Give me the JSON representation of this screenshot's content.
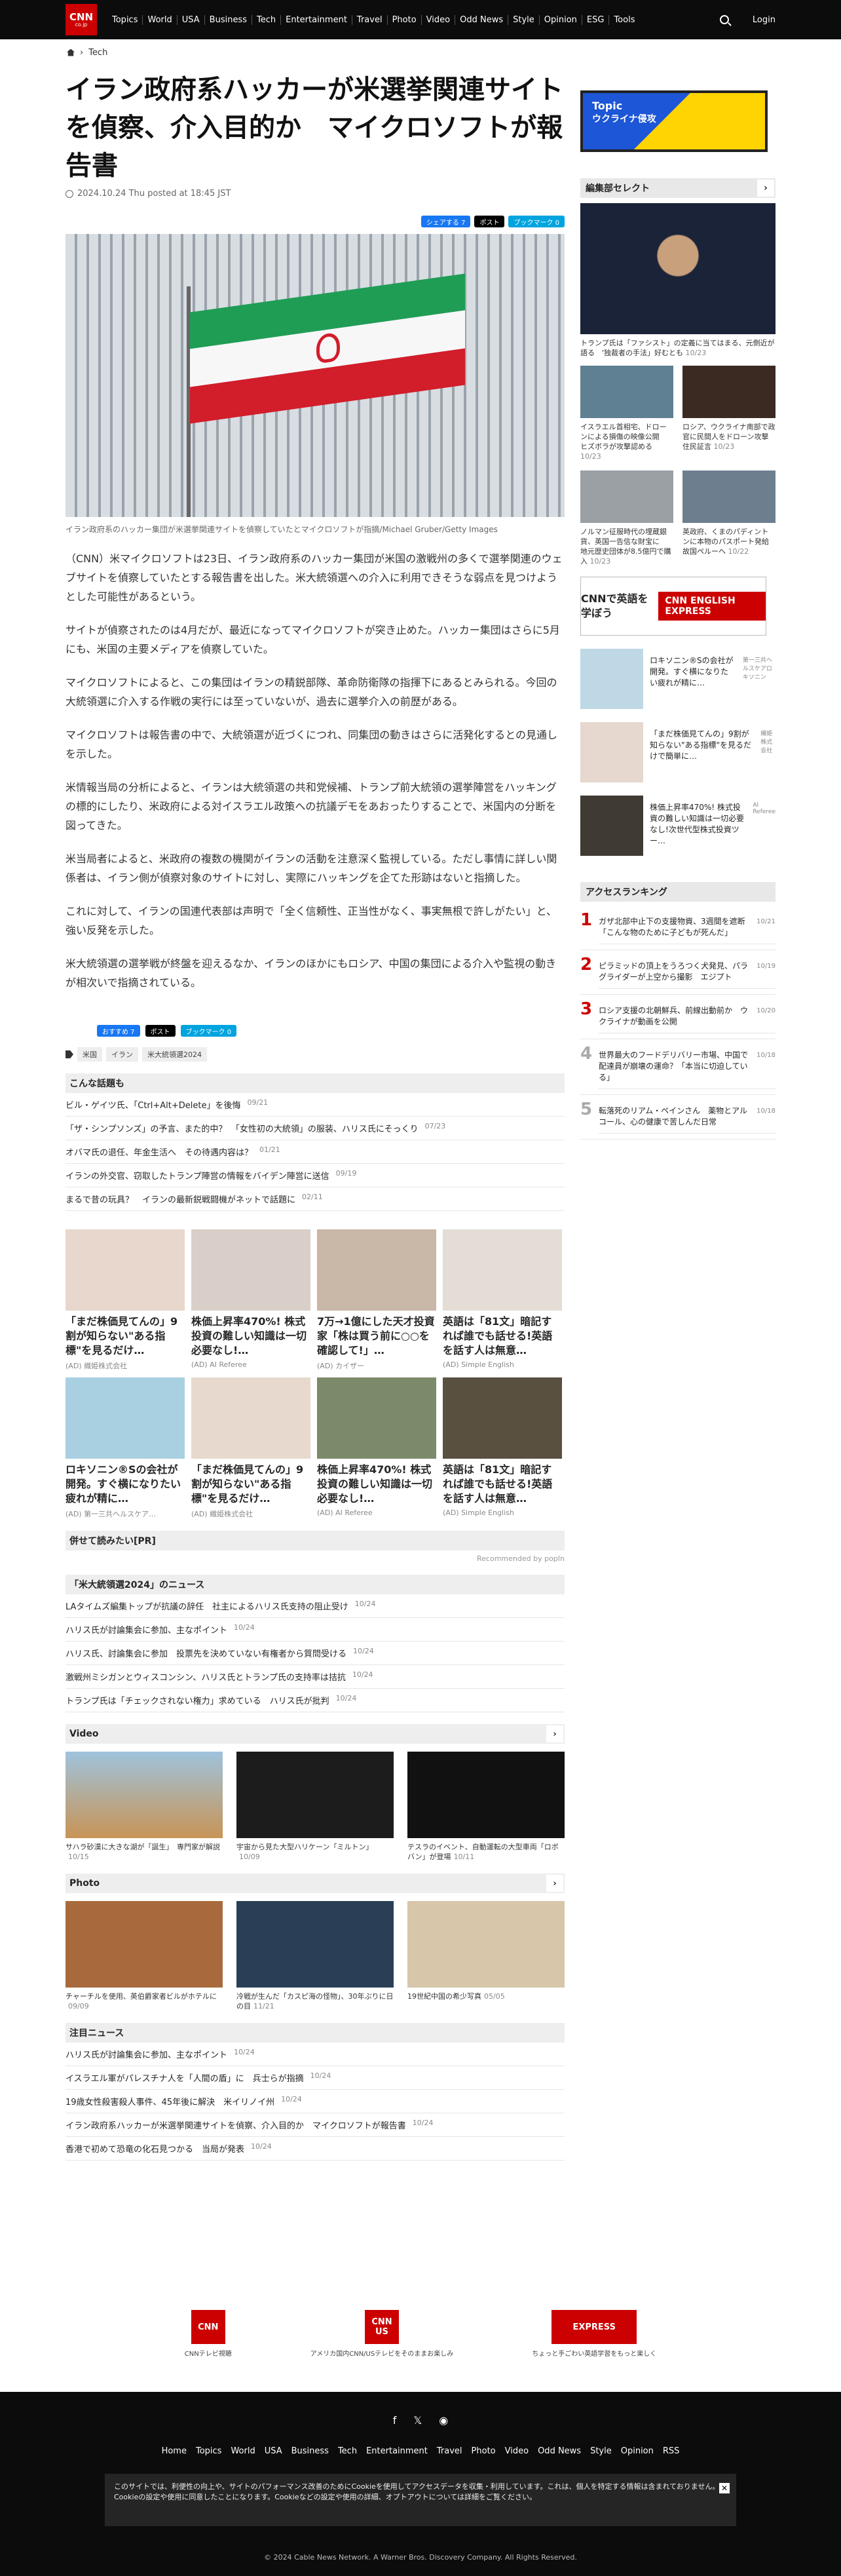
{
  "header": {
    "logo_main": "CNN",
    "logo_sub": "co.jp",
    "nav": [
      "Topics",
      "World",
      "USA",
      "Business",
      "Tech",
      "Entertainment",
      "Travel",
      "Photo",
      "Video",
      "Odd News",
      "Style",
      "Opinion",
      "ESG",
      "Tools"
    ],
    "login": "Login"
  },
  "breadcrumb": {
    "section": "Tech"
  },
  "article": {
    "title": "イラン政府系ハッカーが米選挙関連サイトを偵察、介入目的か　マイクロソフトが報告書",
    "date": "2024.10.24 Thu posted at 18:45 JST",
    "share": [
      "シェアする 7",
      "ポスト",
      "ブックマーク 0"
    ],
    "caption": "イラン政府系のハッカー集団が米選挙関連サイトを偵察していたとマイクロソフトが指摘/Michael Gruber/Getty Images",
    "paragraphs": [
      "（CNN）米マイクロソフトは23日、イラン政府系のハッカー集団が米国の激戦州の多くで選挙関連のウェブサイトを偵察していたとする報告書を出した。米大統領選への介入に利用できそうな弱点を見つけようとした可能性があるという。",
      "サイトが偵察されたのは4月だが、最近になってマイクロソフトが突き止めた。ハッカー集団はさらに5月にも、米国の主要メディアを偵察していた。",
      "マイクロソフトによると、この集団はイランの精鋭部隊、革命防衛隊の指揮下にあるとみられる。今回の大統領選に介入する作戦の実行には至っていないが、過去に選挙介入の前歴がある。",
      "マイクロソフトは報告書の中で、大統領選が近づくにつれ、同集団の動きはさらに活発化するとの見通しを示した。",
      "米情報当局の分析によると、イランは大統領選の共和党候補、トランプ前大統領の選挙陣営をハッキングの標的にしたり、米政府による対イスラエル政策への抗議デモをあおったりすることで、米国内の分断を図ってきた。",
      "米当局者によると、米政府の複数の機関がイランの活動を注意深く監視している。ただし事情に詳しい関係者は、イラン側が偵察対象のサイトに対し、実際にハッキングを企てた形跡はないと指摘した。",
      "これに対して、イランの国連代表部は声明で「全く信頼性、正当性がなく、事実無根で許しがたい」と、強い反発を示した。",
      "米大統領選の選挙戦が終盤を迎えるなか、イランのほかにもロシア、中国の集団による介入や監視の動きが相次いで指摘されている。"
    ],
    "share_bottom": [
      "おすすめ 7",
      "ポスト",
      "ブックマーク 0"
    ],
    "tags": [
      "米国",
      "イラン",
      "米大統領選2024"
    ]
  },
  "related": {
    "title": "こんな話題も",
    "items": [
      {
        "t": "ビル・ゲイツ氏、「Ctrl+Alt+Delete」を後悔",
        "d": "09/21"
      },
      {
        "t": "「ザ・シンプソンズ」の予言、また的中？　「女性初の大統領」の服装、ハリス氏にそっくり",
        "d": "07/23"
      },
      {
        "t": "オバマ氏の退任、年金生活へ　その待遇内容は？",
        "d": "01/21"
      },
      {
        "t": "イランの外交官、窃取したトランプ陣営の情報をバイデン陣営に送信",
        "d": "09/19"
      },
      {
        "t": "まるで昔の玩具？　イランの最新鋭戦闘機がネットで話題に",
        "d": "02/11"
      }
    ]
  },
  "ads": [
    {
      "t": "「まだ株価見てんの」9割が知らない\"ある指標\"を見るだけ…",
      "s": "(AD) 織姫株式会社"
    },
    {
      "t": "株価上昇率470%! 株式投資の難しい知識は一切必要なし!…",
      "s": "(AD) AI Referee"
    },
    {
      "t": "7万→1億にした天才投資家「株は買う前に○○を確認して!」…",
      "s": "(AD) カイザー"
    },
    {
      "t": "英語は「81文」暗記すれば誰でも話せる!英語を話す人は無意…",
      "s": "(AD) Simple English"
    },
    {
      "t": "ロキソニン®Sの会社が開発。すぐ横になりたい疲れが精に…",
      "s": "(AD) 第一三共ヘルスケア…"
    },
    {
      "t": "「まだ株価見てんの」9割が知らない\"ある指標\"を見るだけ…",
      "s": "(AD) 織姫株式会社"
    },
    {
      "t": "株価上昇率470%! 株式投資の難しい知識は一切必要なし!…",
      "s": "(AD) AI Referee"
    },
    {
      "t": "英語は「81文」暗記すれば誰でも話せる!英語を話す人は無意…",
      "s": "(AD) Simple English"
    }
  ],
  "pr": {
    "title": "併せて読みたい[PR]",
    "rec": "Recommended by popIn"
  },
  "election": {
    "title": "「米大統領選2024」のニュース",
    "items": [
      {
        "t": "LAタイムズ編集トップが抗議の辞任　社主によるハリス氏支持の阻止受け",
        "d": "10/24"
      },
      {
        "t": "ハリス氏が討論集会に参加、主なポイント",
        "d": "10/24"
      },
      {
        "t": "ハリス氏、討論集会に参加　投票先を決めていない有権者から質問受ける",
        "d": "10/24"
      },
      {
        "t": "激戦州ミシガンとウィスコンシン、ハリス氏とトランプ氏の支持率は拮抗",
        "d": "10/24"
      },
      {
        "t": "トランプ氏は「チェックされない権力」求めている　ハリス氏が批判",
        "d": "10/24"
      }
    ]
  },
  "video": {
    "title": "Video",
    "items": [
      {
        "t": "サハラ砂漠に大きな湖が「誕生」　専門家が解説",
        "d": "10/15"
      },
      {
        "t": "宇宙から見た大型ハリケーン「ミルトン」",
        "d": "10/09"
      },
      {
        "t": "テスラのイベント、自動運転の大型車両「ロボバン」が登場",
        "d": "10/11"
      }
    ]
  },
  "photo": {
    "title": "Photo",
    "items": [
      {
        "t": "チャーチルを使用、英伯爵家者ビルがホテルに",
        "d": "09/09"
      },
      {
        "t": "冷戦が生んだ「カスピ海の怪物」、30年ぶりに日の目",
        "d": "11/21"
      },
      {
        "t": "19世紀中国の希少写真",
        "d": "05/05"
      }
    ]
  },
  "attention": {
    "title": "注目ニュース",
    "items": [
      {
        "t": "ハリス氏が討論集会に参加、主なポイント",
        "d": "10/24"
      },
      {
        "t": "イスラエル軍がパレスチナ人を「人間の盾」に　兵士らが指摘",
        "d": "10/24"
      },
      {
        "t": "19歳女性殺害殺人事件、45年後に解決　米イリノイ州",
        "d": "10/24"
      },
      {
        "t": "イラン政府系ハッカーが米選挙関連サイトを偵察、介入目的か　マイクロソフトが報告書",
        "d": "10/24"
      },
      {
        "t": "香港で初めて恐竜の化石見つかる　当局が発表",
        "d": "10/24"
      }
    ]
  },
  "sidebar": {
    "topic_label": "Topic",
    "topic_text": "ウクライナ侵攻",
    "editor_title": "編集部セレクト",
    "feature": {
      "t": "トランプ氏は「ファシスト」の定義に当てはまる、元側近が語る　'独裁者の手法」好むとも",
      "d": "10/23"
    },
    "grid": [
      {
        "t": "イスラエル首相宅、ドローンによる損傷の映像公開　ヒズボラが攻撃認める",
        "d": "10/23"
      },
      {
        "t": "ロシア、ウクライナ南部で政官に民間人をドローン攻撃　住民証言",
        "d": "10/23"
      },
      {
        "t": "ノルマン征服時代の埋蔵銀貨、英国一告信な財宝に　地元歴史団体が8.5億円で購入",
        "d": "10/23"
      },
      {
        "t": "英政府、くまのパディントンに本物のパスポート発給　故国ペルーへ",
        "d": "10/22"
      }
    ],
    "cnn_banner_left": "CNNで英語を学ぼう",
    "cnn_banner_right": "CNN ENGLISH EXPRESS",
    "side_ads": [
      {
        "t": "ロキソニン®Sの会社が開発。すぐ横になりたい疲れが精に…",
        "s": "第一三共ヘルスケアロキソニン"
      },
      {
        "t": "「まだ株価見てんの」9割が知らない\"ある指標\"を見るだけで簡単に…",
        "s": "織姫株式会社"
      },
      {
        "t": "株価上昇率470%! 株式投資の難しい知識は一切必要なし!次世代型株式投資ツー…",
        "s": "AI Referee"
      }
    ],
    "ranking_title": "アクセスランキング",
    "ranking": [
      {
        "t": "ガザ北部中止下の支援物資、3週間を遮断「こんな物のために子どもが死んだ」",
        "d": "10/21"
      },
      {
        "t": "ピラミッドの頂上をうろつく犬発見、パラグライダーが上空から撮影　エジプト",
        "d": "10/19"
      },
      {
        "t": "ロシア支援の北朝鮮兵、前線出動前か　ウクライナが動画を公開",
        "d": "10/20"
      },
      {
        "t": "世界最大のフードデリバリー市場、中国で配達員が崩壊の運命？「本当に切迫している」",
        "d": "10/18"
      },
      {
        "t": "転落死のリアム・ペインさん　薬物とアルコール、心の健康で苦しんだ日常",
        "d": "10/18"
      }
    ]
  },
  "footer": {
    "logos": [
      "CNNテレビ視聴",
      "アメリカ国内CNN/USテレビをそのままお楽しみ",
      "ちょっと手ごわい英語学習をもっと楽しく"
    ],
    "nav": [
      "Home",
      "Topics",
      "World",
      "USA",
      "Business",
      "Tech",
      "Entertainment",
      "Travel",
      "Photo",
      "Video",
      "Odd News",
      "Style",
      "Opinion",
      "RSS"
    ],
    "cookie": "このサイトでは、利便性の向上や、サイトのパフォーマンス改善のためにCookieを使用してアクセスデータを収集・利用しています。これは、個人を特定する情報は含まれておりません。Cookieの設定や使用に同意したことになります。Cookieなどの設定や使用の詳細、オプトアウトについては詳細をご覧ください。",
    "copyright": "© 2024 Cable News Network. A Warner Bros. Discovery Company. All Rights Reserved."
  }
}
